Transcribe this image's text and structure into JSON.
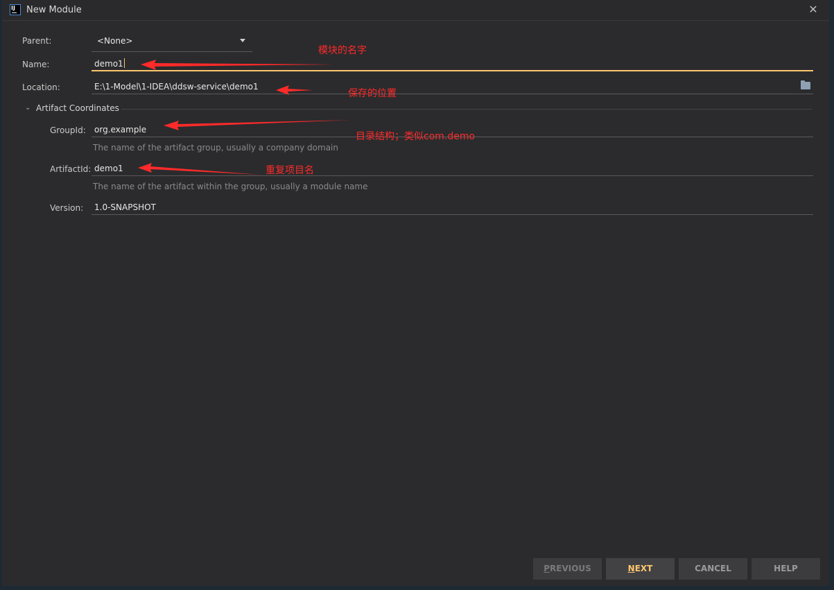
{
  "window": {
    "title": "New Module",
    "icon": "intellij-idea-icon"
  },
  "form": {
    "parent_label": "Parent:",
    "parent_value": "<None>",
    "name_label": "Name:",
    "name_value": "demo1",
    "location_label": "Location:",
    "location_value": "E:\\1-Model\\1-IDEA\\ddsw-service\\demo1",
    "section_title": "Artifact Coordinates",
    "groupid_label": "GroupId:",
    "groupid_value": "org.example",
    "groupid_hint": "The name of the artifact group, usually a company domain",
    "artifactid_label": "ArtifactId:",
    "artifactid_value": "demo1",
    "artifactid_hint": "The name of the artifact within the group, usually a module name",
    "version_label": "Version:",
    "version_value": "1.0-SNAPSHOT"
  },
  "annotations": {
    "name_note": "模块的名字",
    "location_note": "保存的位置",
    "groupid_note": "目录结构；类似com.demo",
    "artifactid_note": "重复项目名"
  },
  "buttons": {
    "previous_first": "P",
    "previous_rest": "REVIOUS",
    "next_first": "N",
    "next_rest": "EXT",
    "cancel": "CANCEL",
    "help": "HELP"
  },
  "colors": {
    "background": "#2b2b2d",
    "accent": "#ffc66d",
    "annotation": "#ff2a2a"
  }
}
